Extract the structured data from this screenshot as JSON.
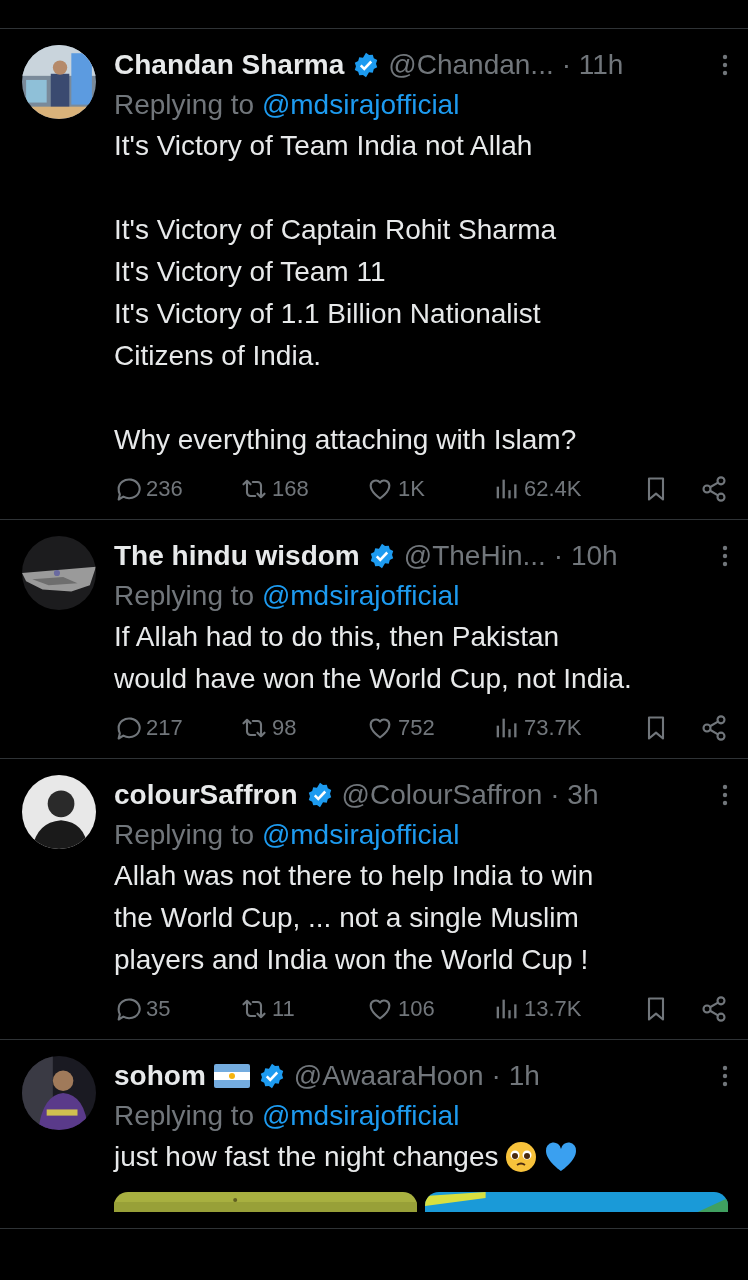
{
  "replies": [
    {
      "name": "Chandan Sharma",
      "verified": true,
      "handle": "@Chandan...",
      "time": "· 11h",
      "replying_label": "Replying to",
      "replying_to": "@mdsirajofficial",
      "body": "It's Victory of Team India not Allah\n\nIt's Victory of Captain Rohit Sharma\nIt's Victory of Team 11\nIt's Victory of 1.1 Billion Nationalist\nCitizens of India.\n\nWhy everything attaching with Islam?",
      "replies": "236",
      "reposts": "168",
      "likes": "1K",
      "views": "62.4K"
    },
    {
      "name": "The hindu wisdom",
      "verified": true,
      "handle": "@TheHin...",
      "time": "· 10h",
      "replying_label": "Replying to",
      "replying_to": "@mdsirajofficial",
      "body": "If Allah had to do this, then Pakistan\nwould have won the World Cup, not India.",
      "replies": "217",
      "reposts": "98",
      "likes": "752",
      "views": "73.7K"
    },
    {
      "name": "colourSaffron",
      "verified": true,
      "handle": "@ColourSaffron",
      "time": "· 3h",
      "replying_label": "Replying to",
      "replying_to": "@mdsirajofficial",
      "body": "Allah was not there to help India to win\nthe World Cup, ... not a single Muslim\nplayers and India won the World Cup !",
      "replies": "35",
      "reposts": "11",
      "likes": "106",
      "views": "13.7K"
    },
    {
      "name": "sohom",
      "flag": true,
      "verified": true,
      "handle": "@AwaaraHoon",
      "time": "· 1h",
      "replying_label": "Replying to",
      "replying_to": "@mdsirajofficial",
      "body": "just how fast the night changes",
      "emoji": true
    }
  ]
}
